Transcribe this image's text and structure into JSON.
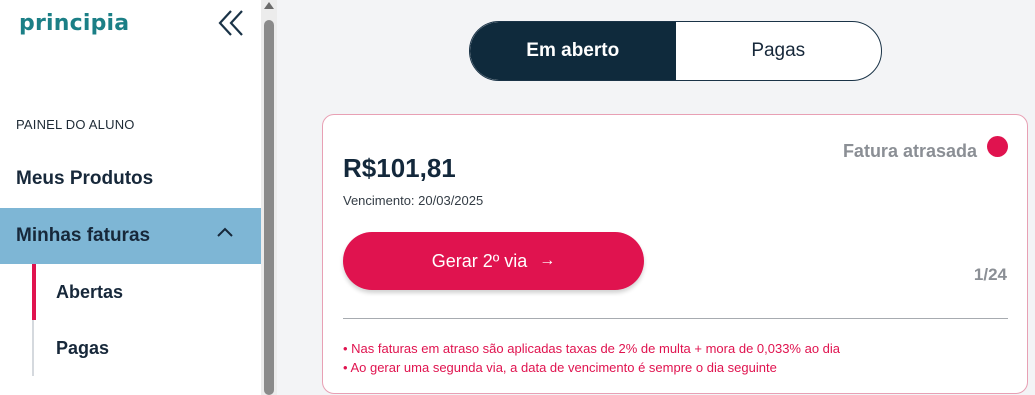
{
  "sidebar": {
    "logo": "principia",
    "section_title": "PAINEL DO ALUNO",
    "items": [
      {
        "label": "Meus Produtos"
      },
      {
        "label": "Minhas faturas",
        "expanded": true
      }
    ],
    "subitems": [
      {
        "label": "Abertas",
        "active": true
      },
      {
        "label": "Pagas",
        "active": false
      }
    ]
  },
  "tabs": {
    "open_label": "Em aberto",
    "paid_label": "Pagas",
    "selected": "Em aberto"
  },
  "invoice": {
    "status": "Fatura atrasada",
    "amount": "R$101,81",
    "due": "Vencimento: 20/03/2025",
    "button_label": "Gerar 2º via",
    "button_arrow": "→",
    "pager": "1/24",
    "notes": [
      "• Nas faturas em atraso são aplicadas taxas de 2% de multa + mora de 0,033% ao dia",
      "• Ao gerar uma segunda via, a data de vencimento é sempre o dia seguinte"
    ]
  },
  "colors": {
    "brand_teal": "#1b7f86",
    "accent_red": "#e0134f",
    "navy": "#0f2a3c",
    "active_nav_bg": "#7eb6d5"
  },
  "icons": {
    "collapse": "double-chevron-left-icon",
    "expand": "chevron-up-icon",
    "status": "red-dot-icon"
  }
}
